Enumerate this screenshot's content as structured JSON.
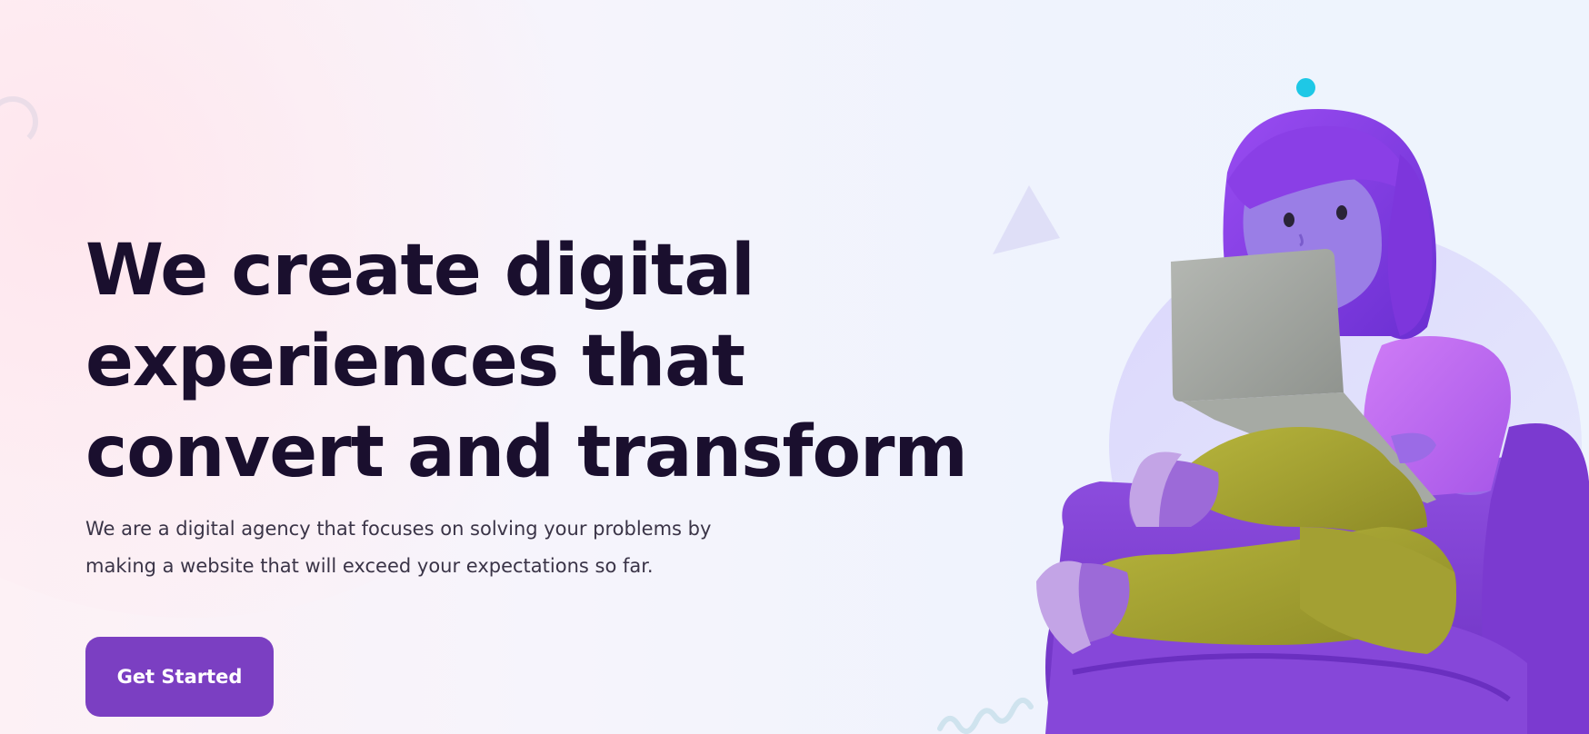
{
  "hero": {
    "headline_line1": "We create digital",
    "headline_line2": "experiences that",
    "headline_line3": "convert and transform",
    "subtext_line1": "We are a digital agency that focuses on solving your problems by",
    "subtext_line2": "making a website that will exceed your expectations so far.",
    "cta_label": "Get Started"
  },
  "colors": {
    "headline": "#1a0f2e",
    "cta_background": "#7b3fc2",
    "accent_dot": "#1ec8e6"
  },
  "icons": {
    "decor_triangle": "triangle-shape",
    "decor_dot": "dot-shape",
    "decor_squiggle": "squiggle-shape",
    "hero_image": "girl-with-laptop-on-armchair"
  }
}
